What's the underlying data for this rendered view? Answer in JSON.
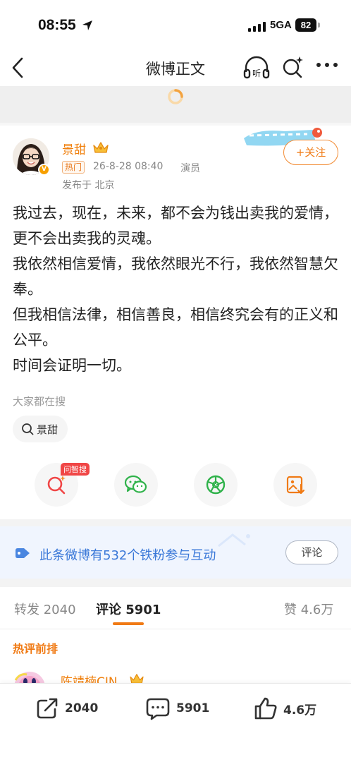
{
  "status_bar": {
    "time": "08:55",
    "network": "5GA",
    "battery": "82"
  },
  "nav": {
    "title": "微博正文"
  },
  "author": {
    "name": "景甜",
    "hot_tag": "热门",
    "time": "26-8-28 08:40",
    "source": "演员",
    "location": "发布于 北京",
    "follow_label": "+关注"
  },
  "post": {
    "text": "我过去，现在，未来，都不会为钱出卖我的爱情，更不会出卖我的灵魂。\n我依然相信爱情，我依然眼光不行，我依然智慧欠奉。\n但我相信法律，相信善良，相信终究会有的正义和公平。\n时间会证明一切。"
  },
  "search": {
    "hint": "大家都在搜",
    "chip": "景甜"
  },
  "actions": {
    "ai_tag": "问智搜"
  },
  "fans_bar": {
    "text": "此条微博有532个铁粉参与互动",
    "button": "评论"
  },
  "tabs": {
    "reposts": "转发 2040",
    "comments": "评论 5901",
    "likes": "赞 4.6万"
  },
  "comments": {
    "section_title": "热评前排",
    "first_user": "陈靖楠CJN"
  },
  "bottom_bar": {
    "reposts": "2040",
    "comments": "5901",
    "likes": "4.6万"
  },
  "colors": {
    "accent": "#f07a14",
    "link_blue": "#3a78d8"
  }
}
